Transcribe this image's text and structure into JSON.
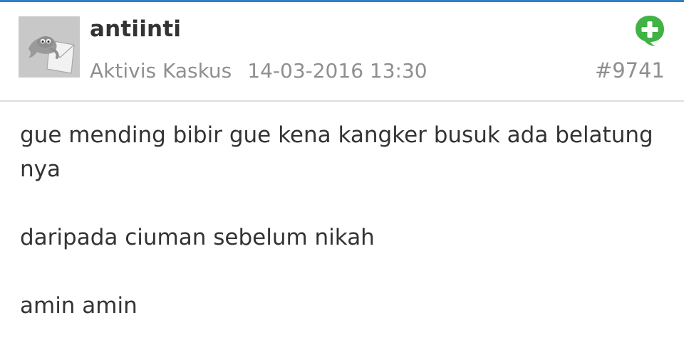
{
  "post": {
    "username": "antiinti",
    "rank": "Aktivis Kaskus",
    "datetime": "14-03-2016 13:30",
    "post_number": "#9741",
    "quote_icon": "quote-plus-icon",
    "avatar_icon": "default-avatar-icon",
    "body": {
      "p1": "gue mending bibir gue kena kangker busuk ada belatung nya",
      "p2": "daripada ciuman sebelum nikah",
      "p3": "amin amin"
    }
  },
  "colors": {
    "accent_top_rule": "#2f7fc4",
    "quote_green": "#3fb344",
    "text_primary": "#333333",
    "text_muted": "#8f8f8f",
    "avatar_bg": "#c8c8c8"
  }
}
